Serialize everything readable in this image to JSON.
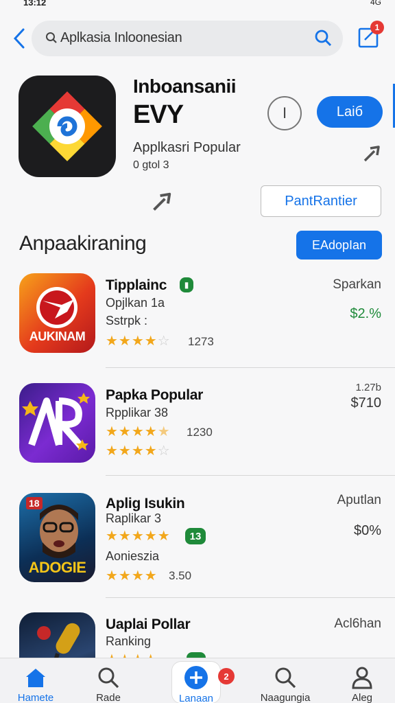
{
  "status_bar": {
    "time": "13:12",
    "right": "4G"
  },
  "search": {
    "query": "Aplkasia Inloonesian",
    "edit_badge": "1"
  },
  "app": {
    "title_line1": "Inboansanii",
    "title_line2": "EVY",
    "category": "Applkasri Popular",
    "meta": "0 gtol 3",
    "info_label": "I",
    "get_label": "Laiб",
    "secondary_button": "PantRantier"
  },
  "section": {
    "title": "Anpaakiraning",
    "button_label": "EAdopIan"
  },
  "list": [
    {
      "name": "Tipplainc",
      "line1": "Opjlkan 1a",
      "line2": "Sstrpk :",
      "stars": 4,
      "rating_count": "1273",
      "right_label": "Sparkan",
      "price": "$2.%",
      "thumb_text": "AUKINAM"
    },
    {
      "name": "Papka Popular",
      "line1": "Rpplikar 38",
      "stars": 4.5,
      "rating_count": "1230",
      "stars2": 4,
      "right_label": "1.27b",
      "price": "$710"
    },
    {
      "name": "Aplig Isukin",
      "line1": "Raplikar 3",
      "stars": 5,
      "tag": "13",
      "line2": "Aonieszia",
      "stars2": 4,
      "rating_count": "3.50",
      "right_label": "Aputlan",
      "price": "$0%",
      "thumb_text": "ADOGIE",
      "thumb_badge": "18"
    },
    {
      "name": "Uaplai Pollar",
      "line1": "Ranking",
      "right_label": "Acl6han"
    }
  ],
  "tabs": [
    {
      "label": "Hamete",
      "icon": "home-icon"
    },
    {
      "label": "Rade",
      "icon": "search-icon"
    },
    {
      "label": "Lanaan",
      "icon": "plus-icon",
      "badge": "2"
    },
    {
      "label": "Naagungia",
      "icon": "search-icon"
    },
    {
      "label": "Aleg",
      "icon": "person-icon"
    }
  ],
  "colors": {
    "accent": "#1573e8",
    "badge": "#e53935",
    "star": "#f2a71b",
    "green": "#1f8a3a"
  }
}
